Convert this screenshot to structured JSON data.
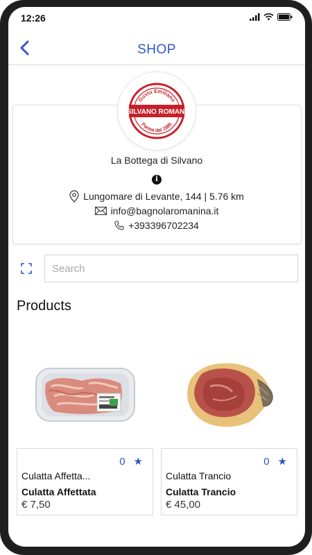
{
  "status_bar": {
    "time": "12:26"
  },
  "header": {
    "title": "SHOP"
  },
  "shop": {
    "logo_text_main": "SILVANO ROMANI",
    "logo_text_top": "Gusto Emiliano",
    "logo_text_bottom": "Parma dal 1985",
    "name": "La Bottega di Silvano",
    "address": "Lungomare di Levante, 144 | 5.76 km",
    "email": "info@bagnolaromanina.it",
    "phone": "+393396702234"
  },
  "search": {
    "placeholder": "Search",
    "value": ""
  },
  "products_heading": "Products",
  "products": [
    {
      "title": "Culatta Affetta...",
      "name": "Culatta Affettata",
      "price": "€ 7,50",
      "rating": "0",
      "image": "sliced-ham-tray"
    },
    {
      "title": "Culatta Trancio",
      "name": "Culatta Trancio",
      "price": "€ 45,00",
      "rating": "0",
      "image": "ham-piece"
    }
  ],
  "colors": {
    "accent": "#2f56c8",
    "logo_red": "#c8202a"
  }
}
